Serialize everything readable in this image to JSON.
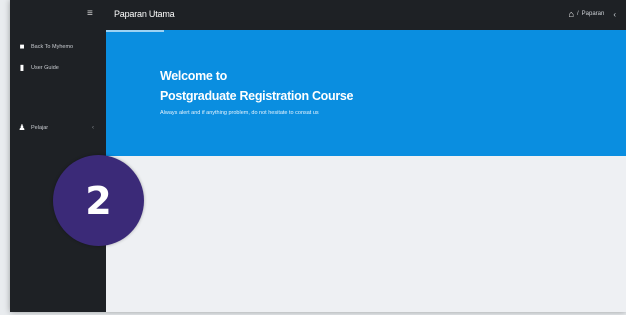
{
  "colors": {
    "topbar": "#1e2125",
    "sidebar": "#1e2125",
    "hero": "#0a8ee0",
    "badge": "#3b2a78",
    "content": "#eef0f3"
  },
  "header": {
    "menu_icon": "hamburger-icon",
    "title": "Paparan Utama",
    "home_icon": "home-icon",
    "breadcrumb_separator": "/",
    "breadcrumb": "Paparan",
    "collapse_icon": "chevron-left-icon",
    "collapse_glyph": "‹"
  },
  "sidebar": {
    "items": [
      {
        "label": "Back To Myhemo",
        "icon": "dashboard-icon"
      },
      {
        "label": "User Guide",
        "icon": "document-icon"
      },
      {
        "label": "Pelajar",
        "icon": "user-icon",
        "chevron": "‹"
      }
    ]
  },
  "hero": {
    "title_line1": "Welcome to",
    "title_line2": "Postgraduate Registration Course",
    "subtitle": "Always alert and if anything problem, do not hesitate to consat us"
  },
  "step_badge": {
    "number": "2"
  }
}
